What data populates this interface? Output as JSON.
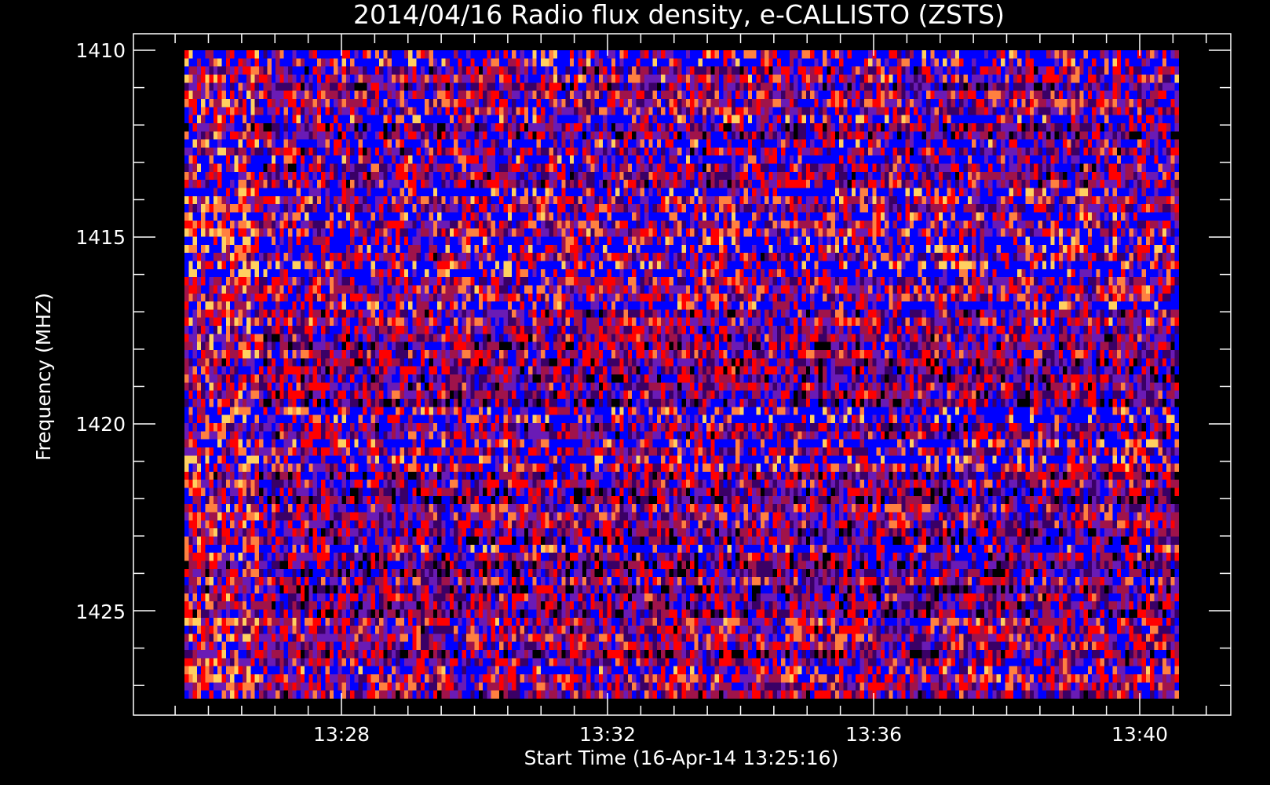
{
  "chart_data": {
    "type": "heatmap",
    "title": "2014/04/16  Radio flux density, e-CALLISTO (ZSTS)",
    "xlabel": "Start Time (16-Apr-14 13:25:16)",
    "ylabel": "Frequency (MHZ)",
    "x_tick_labels": [
      "13:28",
      "13:32",
      "13:36",
      "13:40"
    ],
    "y_tick_labels": [
      "1410",
      "1415",
      "1420",
      "1425"
    ],
    "ylim": [
      1409.5,
      1427.8
    ],
    "frequency_range_mhz": [
      1410,
      1427.3
    ],
    "time_range": [
      "13:25:16",
      "13:40:16"
    ],
    "colormap": [
      "#000000",
      "#3a0066",
      "#6a1bb5",
      "#0000ff",
      "#a0134a",
      "#ff0000",
      "#ff8040",
      "#ffd060"
    ],
    "background": "#000000",
    "axis_color": "#ffffff"
  }
}
